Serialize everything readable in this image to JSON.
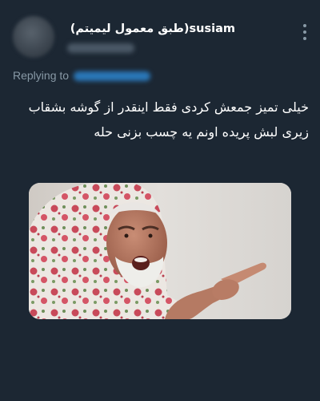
{
  "tweet": {
    "display_name": "(طبق معمول لیمیتم)susiam",
    "more_icon": "more-vertical-icon",
    "replying_label": "Replying to",
    "text": "خیلی تمیز جمعش کردی فقط اینقدر از گوشه بشقاب زیری لبش پریده اونم یه چسب بزنی حله",
    "media": {
      "type": "image",
      "description_icon": "meme-image"
    }
  },
  "colors": {
    "background": "#1c2733",
    "text_primary": "#ffffff",
    "text_secondary": "#8899a6",
    "link": "#2a77b8"
  }
}
